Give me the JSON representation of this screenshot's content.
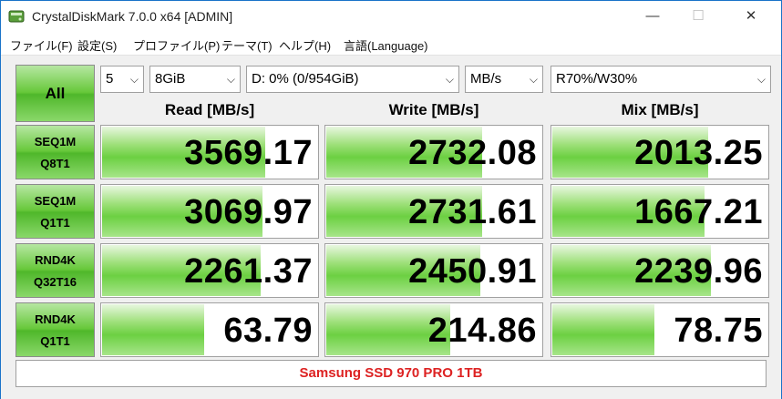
{
  "window": {
    "title": "CrystalDiskMark 7.0.0 x64 [ADMIN]",
    "minimize_glyph": "—",
    "maximize_glyph": "☐",
    "close_glyph": "✕"
  },
  "menu": {
    "items": [
      "ファイル(F)",
      "設定(S)",
      "プロファイル(P)",
      "テーマ(T)",
      "ヘルプ(H)",
      "言語(Language)"
    ]
  },
  "controls": {
    "all_label": "All",
    "count": "5",
    "size": "8GiB",
    "drive": "D: 0% (0/954GiB)",
    "unit": "MB/s",
    "mix": "R70%/W30%",
    "chevron": "⌵"
  },
  "columns": {
    "read": "Read [MB/s]",
    "write": "Write [MB/s]",
    "mix": "Mix [MB/s]"
  },
  "rows": [
    {
      "label1": "SEQ1M",
      "label2": "Q8T1",
      "read": "3569.17",
      "write": "2732.08",
      "mix": "2013.25",
      "read_fill": 0.75,
      "write_fill": 0.72,
      "mix_fill": 0.72
    },
    {
      "label1": "SEQ1M",
      "label2": "Q1T1",
      "read": "3069.97",
      "write": "2731.61",
      "mix": "1667.21",
      "read_fill": 0.74,
      "write_fill": 0.72,
      "mix_fill": 0.7
    },
    {
      "label1": "RND4K",
      "label2": "Q32T16",
      "read": "2261.37",
      "write": "2450.91",
      "mix": "2239.96",
      "read_fill": 0.73,
      "write_fill": 0.71,
      "mix_fill": 0.73
    },
    {
      "label1": "RND4K",
      "label2": "Q1T1",
      "read": "63.79",
      "write": "214.86",
      "mix": "78.75",
      "read_fill": 0.47,
      "write_fill": 0.57,
      "mix_fill": 0.47
    }
  ],
  "footer": {
    "drive_name": "Samsung SSD 970 PRO 1TB"
  },
  "colors": {
    "accent_green": "#5cc233",
    "footer_red": "#dd2222",
    "window_border": "#1a73c9"
  }
}
